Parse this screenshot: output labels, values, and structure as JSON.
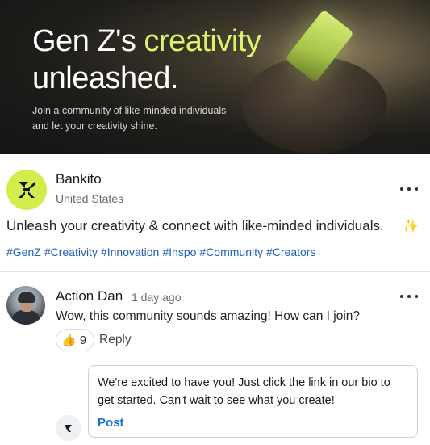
{
  "banner": {
    "headline_prefix": "Gen Z's ",
    "headline_accent": "creativity",
    "headline_line2": "unleashed.",
    "subtext_line1": "Join a community of like-minded individuals",
    "subtext_line2": "and let your creativity shine.",
    "accent_color": "#d9f36b"
  },
  "post": {
    "author": "Bankito",
    "location": "United States",
    "avatar_icon": "bankito-logo-icon",
    "text": "Unleash your creativity & connect with like-minded individuals.",
    "emoji": "✨",
    "hashtags": [
      "#GenZ",
      "#Creativity",
      "#Innovation",
      "#Inspo",
      "#Community",
      "#Creators"
    ],
    "hashtag_color": "#1f5fb8"
  },
  "comment": {
    "author": "Action Dan",
    "time": "1 day ago",
    "text": "Wow, this community sounds amazing! How can I join?",
    "reaction_emoji": "👍",
    "reaction_count": "9",
    "reply_label": "Reply"
  },
  "reply_draft": {
    "text": "We're excited to have you! Just click the link in our bio to get started. Can't wait to see what you create!",
    "post_label": "Post",
    "post_color": "#1a73d9"
  }
}
